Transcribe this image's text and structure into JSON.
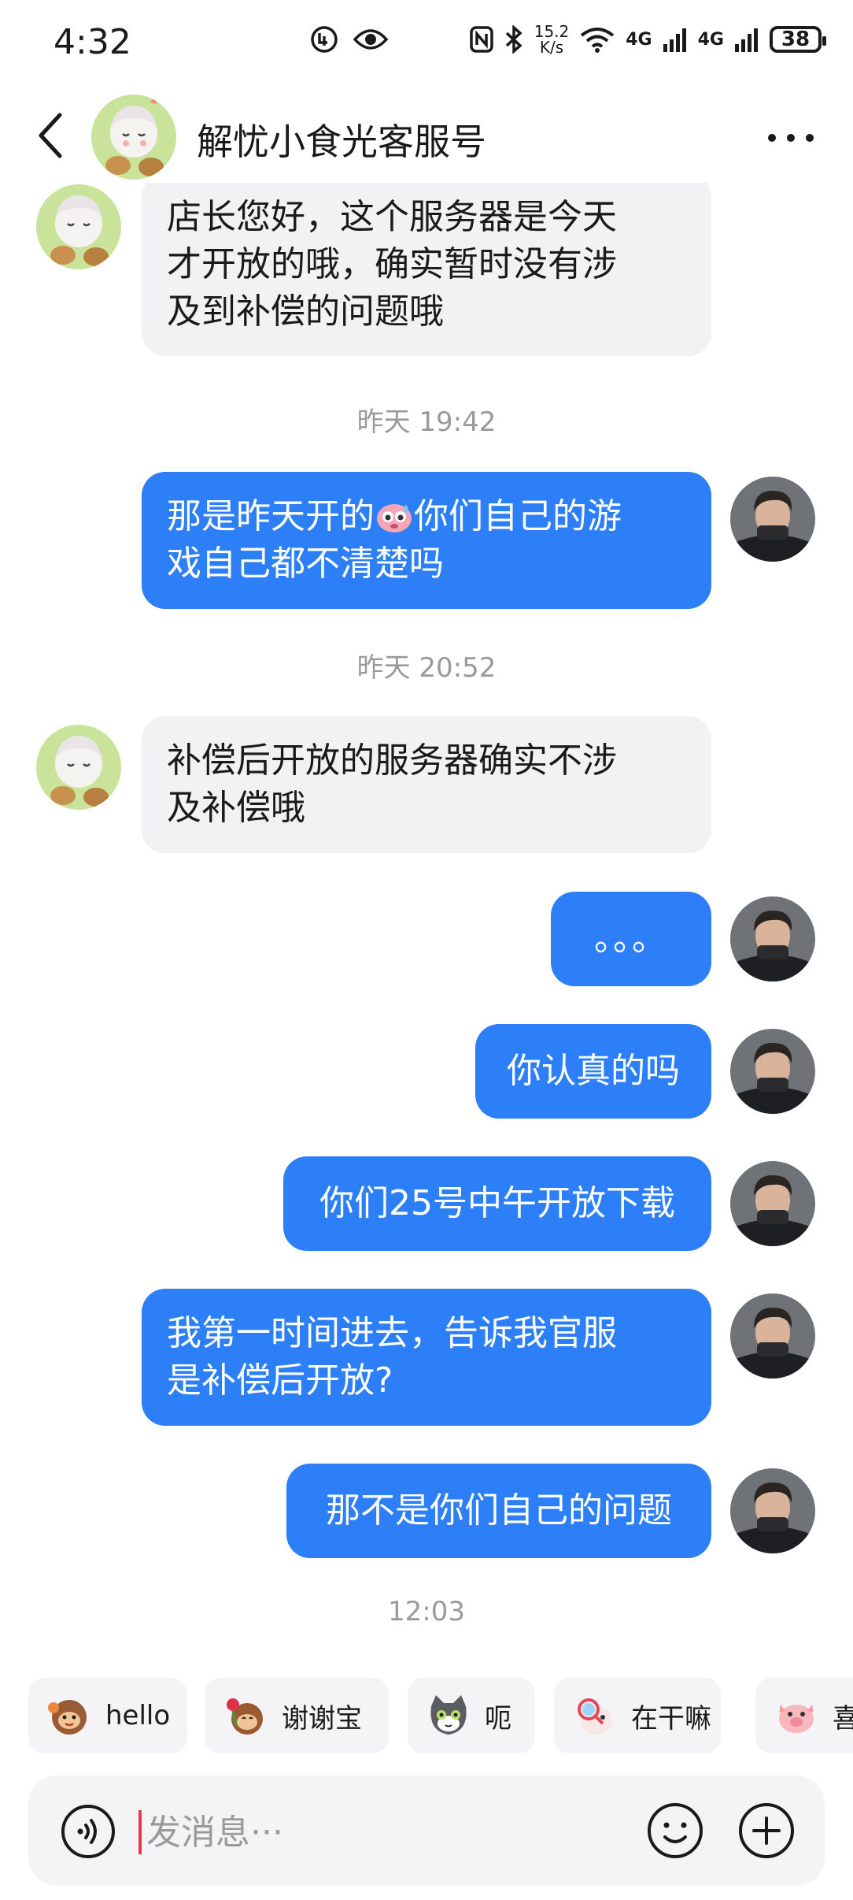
{
  "status_bar": {
    "time": "4:32",
    "speed_value": "15.2",
    "speed_unit": "K/s",
    "net1": "4G",
    "net2": "4G",
    "battery": "38"
  },
  "header": {
    "title": "解忧小食光客服号",
    "avatar_icon": "anime-girl-avatar",
    "back_icon": "back-arrow-icon",
    "more_icon": "more-dots-icon"
  },
  "messages": [
    {
      "side": "in",
      "lines": [
        "店长您好，这个服务器是今天",
        "才开放的哦，确实暂时没有涉",
        "及到补偿的问题哦"
      ]
    },
    {
      "side": "time",
      "text": "昨天 19:42"
    },
    {
      "side": "out",
      "lines": [
        "那是昨天开的",
        "你们自己的游",
        "戏自己都不清楚吗"
      ]
    },
    {
      "side": "time",
      "text": "昨天 20:52"
    },
    {
      "side": "in",
      "lines": [
        "补偿后开放的服务器确实不涉",
        "及补偿哦"
      ]
    },
    {
      "side": "out",
      "lines": [
        "。。。"
      ]
    },
    {
      "side": "out",
      "lines": [
        "你认真的吗"
      ]
    },
    {
      "side": "out",
      "lines": [
        "你们25号中午开放下载"
      ]
    },
    {
      "side": "out",
      "lines": [
        "我第一时间进去，告诉我官服",
        "是补偿后开放?"
      ]
    },
    {
      "side": "out",
      "lines": [
        "那不是你们自己的问题"
      ]
    },
    {
      "side": "time",
      "text": "12:03"
    }
  ],
  "quick_replies": [
    {
      "label": "hello",
      "icon": "monkey-wave-icon"
    },
    {
      "label": "谢谢宝",
      "icon": "monkey-rose-icon"
    },
    {
      "label": "呃",
      "icon": "cat-face-icon"
    },
    {
      "label": "在干嘛",
      "icon": "magnifier-sticker-icon"
    },
    {
      "label": "喜",
      "icon": "pig-sticker-icon"
    }
  ],
  "input": {
    "placeholder": "发消息···",
    "value": ""
  },
  "colors": {
    "outgoing_bubble": "#2c7ff6",
    "incoming_bubble": "#f2f2f4",
    "timestamp": "#9a9a9a"
  }
}
